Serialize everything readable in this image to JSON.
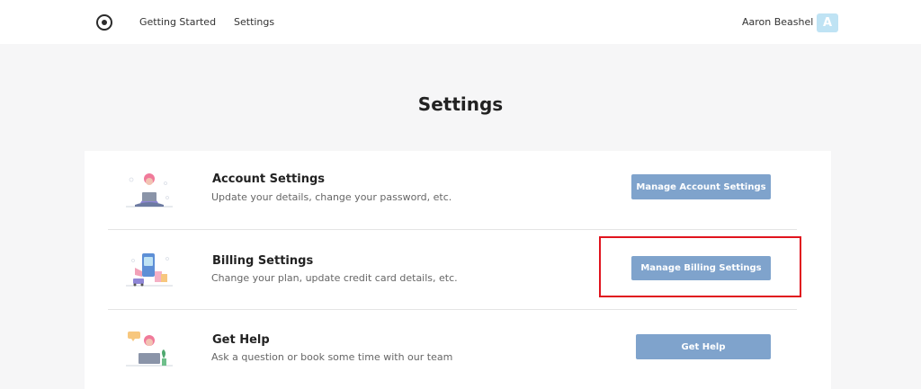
{
  "nav": {
    "links": [
      "Getting Started",
      "Settings"
    ],
    "user_name": "Aaron Beashel",
    "avatar_letter": "A"
  },
  "page": {
    "title": "Settings"
  },
  "sections": [
    {
      "title": "Account Settings",
      "description": "Update your details, change your password, etc.",
      "button": "Manage Account Settings"
    },
    {
      "title": "Billing Settings",
      "description": "Change your plan, update credit card details, etc.",
      "button": "Manage Billing Settings"
    },
    {
      "title": "Get Help",
      "description": "Ask a question or book some time with our team",
      "button": "Get Help"
    }
  ],
  "colors": {
    "button": "#7fa3cc",
    "highlight": "#e0141e",
    "avatar": "#bfe3f4"
  }
}
